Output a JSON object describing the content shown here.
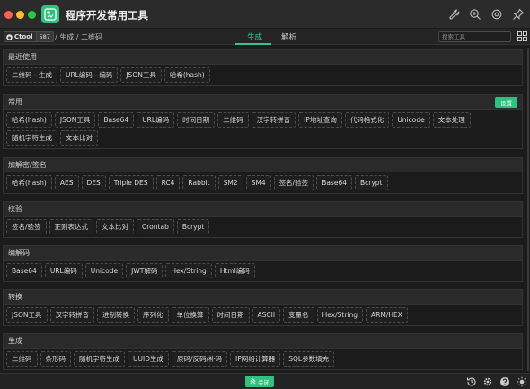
{
  "app": {
    "title": "程序开发常用工具"
  },
  "colors": {
    "accent": "#2ec27e",
    "background": "#1b1b1b"
  },
  "navbar": {
    "ctool_label": "Ctool",
    "ctool_count": "587",
    "breadcrumb": "/ 生成 / 二维码",
    "tabs": [
      {
        "label": "生成"
      },
      {
        "label": "解析"
      }
    ],
    "search_placeholder": "搜索工具"
  },
  "sections": [
    {
      "title": "最近使用",
      "items": [
        "二维码 - 生成",
        "URL编码 - 编码",
        "JSON工具",
        "哈希(hash)"
      ]
    },
    {
      "title": "常用",
      "action": "设置",
      "items": [
        "哈希(hash)",
        "JSON工具",
        "Base64",
        "URL编码",
        "时间日期",
        "二维码",
        "汉字转拼音",
        "IP地址查询",
        "代码格式化",
        "Unicode",
        "文本处理",
        "随机字符生成",
        "文本比对"
      ]
    },
    {
      "title": "加解密/签名",
      "items": [
        "哈希(hash)",
        "AES",
        "DES",
        "Triple DES",
        "RC4",
        "Rabbit",
        "SM2",
        "SM4",
        "签名/验签",
        "Base64",
        "Bcrypt"
      ]
    },
    {
      "title": "校验",
      "items": [
        "签名/验签",
        "正则表达式",
        "文本比对",
        "Crontab",
        "Bcrypt"
      ]
    },
    {
      "title": "编解码",
      "items": [
        "Base64",
        "URL编码",
        "Unicode",
        "JWT解码",
        "Hex/String",
        "Html编码"
      ]
    },
    {
      "title": "转换",
      "items": [
        "JSON工具",
        "汉字转拼音",
        "进制转换",
        "序列化",
        "单位换算",
        "时间日期",
        "ASCII",
        "变量名",
        "Hex/String",
        "ARM/HEX"
      ]
    },
    {
      "title": "生成",
      "items": [
        "二维码",
        "条形码",
        "随机字符生成",
        "UUID生成",
        "原码/反码/补码",
        "IP网络计算器",
        "SQL参数填充"
      ]
    }
  ],
  "footer": {
    "close_label": "关闭"
  }
}
